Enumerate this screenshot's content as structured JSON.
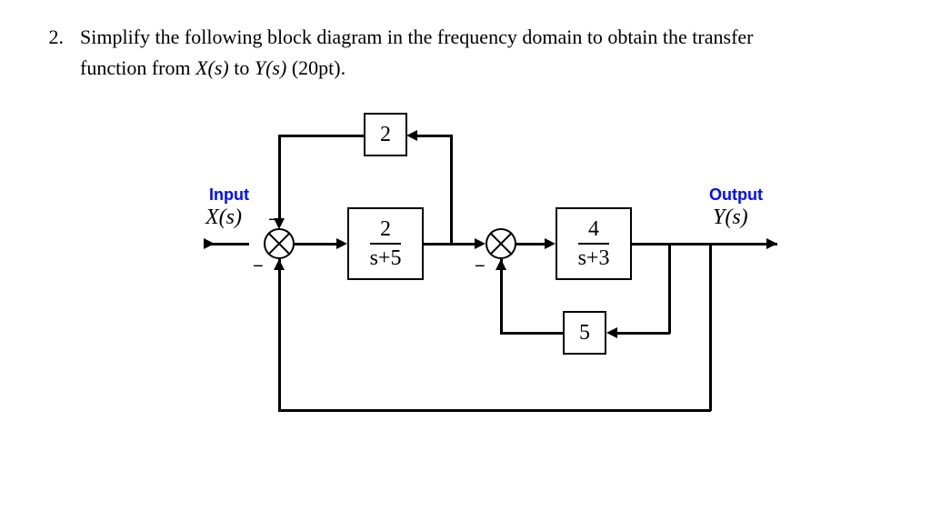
{
  "problem": {
    "number": "2.",
    "text_line1_a": "Simplify the following block diagram in the frequency domain to obtain the transfer",
    "text_line2_a": "function from ",
    "X": "X(s)",
    "text_line2_b": " to ",
    "Y": "Y(s)",
    "text_line2_c": " (20pt)."
  },
  "labels": {
    "input": "Input",
    "output": "Output",
    "X": "X(s)",
    "Y": "Y(s)"
  },
  "blocks": {
    "feedback_top": "2",
    "g1_num": "2",
    "g1_den": "s+5",
    "g2_num": "4",
    "g2_den": "s+3",
    "inner_fb": "5"
  },
  "signs": {
    "sum1_top": "−",
    "sum1_bot": "−",
    "sum2_bot": "−"
  }
}
